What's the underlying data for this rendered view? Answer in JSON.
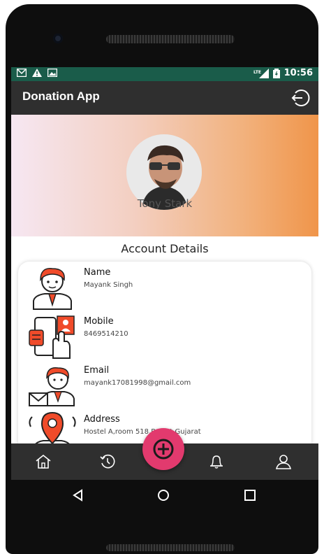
{
  "status": {
    "network": "LTE",
    "time": "10:56"
  },
  "app": {
    "title": "Donation App"
  },
  "profile": {
    "name": "Tony Stark"
  },
  "section": {
    "title": "Account Details"
  },
  "details": [
    {
      "label": "Name",
      "value": "Mayank Singh",
      "icon": "person-icon"
    },
    {
      "label": "Mobile",
      "value": "8469514210",
      "icon": "mobile-contact-icon"
    },
    {
      "label": "Email",
      "value": "mayank17081998@gmail.com",
      "icon": "email-person-icon"
    },
    {
      "label": "Address",
      "value": "Hostel A,room 518,Rajkot,Gujarat",
      "icon": "location-person-icon"
    }
  ],
  "nav": [
    "home-icon",
    "history-icon",
    "add-icon",
    "notifications-icon",
    "profile-icon"
  ],
  "colors": {
    "accent": "#e23a6e",
    "appbar": "#2f2f2f",
    "statusbar": "#1a5c4a",
    "icon_orange": "#f04b2a"
  }
}
